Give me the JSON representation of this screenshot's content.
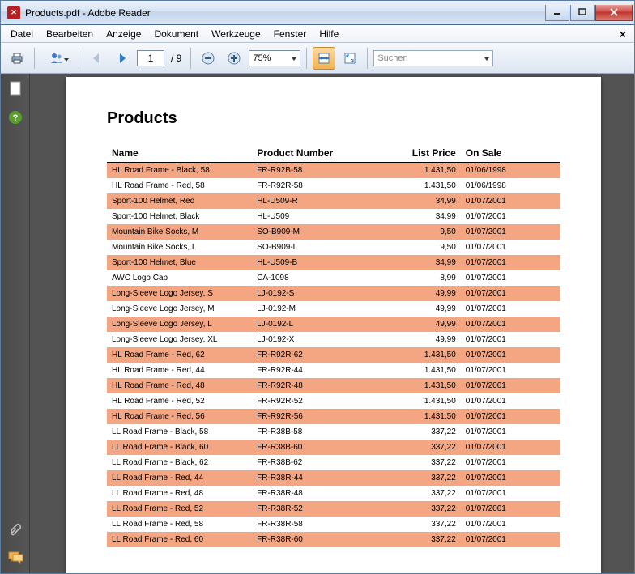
{
  "window": {
    "title": "Products.pdf - Adobe Reader"
  },
  "menu": {
    "items": [
      "Datei",
      "Bearbeiten",
      "Anzeige",
      "Dokument",
      "Werkzeuge",
      "Fenster",
      "Hilfe"
    ]
  },
  "toolbar": {
    "page_current": "1",
    "page_total": "/ 9",
    "zoom": "75%",
    "search_placeholder": "Suchen"
  },
  "document": {
    "title": "Products",
    "headers": {
      "name": "Name",
      "product_number": "Product Number",
      "list_price": "List Price",
      "on_sale": "On Sale"
    },
    "rows": [
      {
        "hl": true,
        "name": "HL Road Frame - Black, 58",
        "num": "FR-R92B-58",
        "price": "1.431,50",
        "date": "01/06/1998"
      },
      {
        "hl": false,
        "name": "HL Road Frame - Red, 58",
        "num": "FR-R92R-58",
        "price": "1.431,50",
        "date": "01/06/1998"
      },
      {
        "hl": true,
        "name": "Sport-100 Helmet, Red",
        "num": "HL-U509-R",
        "price": "34,99",
        "date": "01/07/2001"
      },
      {
        "hl": false,
        "name": "Sport-100 Helmet, Black",
        "num": "HL-U509",
        "price": "34,99",
        "date": "01/07/2001"
      },
      {
        "hl": true,
        "name": "Mountain Bike Socks, M",
        "num": "SO-B909-M",
        "price": "9,50",
        "date": "01/07/2001"
      },
      {
        "hl": false,
        "name": "Mountain Bike Socks, L",
        "num": "SO-B909-L",
        "price": "9,50",
        "date": "01/07/2001"
      },
      {
        "hl": true,
        "name": "Sport-100 Helmet, Blue",
        "num": "HL-U509-B",
        "price": "34,99",
        "date": "01/07/2001"
      },
      {
        "hl": false,
        "name": "AWC Logo Cap",
        "num": "CA-1098",
        "price": "8,99",
        "date": "01/07/2001"
      },
      {
        "hl": true,
        "name": "Long-Sleeve Logo Jersey, S",
        "num": "LJ-0192-S",
        "price": "49,99",
        "date": "01/07/2001"
      },
      {
        "hl": false,
        "name": "Long-Sleeve Logo Jersey, M",
        "num": "LJ-0192-M",
        "price": "49,99",
        "date": "01/07/2001"
      },
      {
        "hl": true,
        "name": "Long-Sleeve Logo Jersey, L",
        "num": "LJ-0192-L",
        "price": "49,99",
        "date": "01/07/2001"
      },
      {
        "hl": false,
        "name": "Long-Sleeve Logo Jersey, XL",
        "num": "LJ-0192-X",
        "price": "49,99",
        "date": "01/07/2001"
      },
      {
        "hl": true,
        "name": "HL Road Frame - Red, 62",
        "num": "FR-R92R-62",
        "price": "1.431,50",
        "date": "01/07/2001"
      },
      {
        "hl": false,
        "name": "HL Road Frame - Red, 44",
        "num": "FR-R92R-44",
        "price": "1.431,50",
        "date": "01/07/2001"
      },
      {
        "hl": true,
        "name": "HL Road Frame - Red, 48",
        "num": "FR-R92R-48",
        "price": "1.431,50",
        "date": "01/07/2001"
      },
      {
        "hl": false,
        "name": "HL Road Frame - Red, 52",
        "num": "FR-R92R-52",
        "price": "1.431,50",
        "date": "01/07/2001"
      },
      {
        "hl": true,
        "name": "HL Road Frame - Red, 56",
        "num": "FR-R92R-56",
        "price": "1.431,50",
        "date": "01/07/2001"
      },
      {
        "hl": false,
        "name": "LL Road Frame - Black, 58",
        "num": "FR-R38B-58",
        "price": "337,22",
        "date": "01/07/2001"
      },
      {
        "hl": true,
        "name": "LL Road Frame - Black, 60",
        "num": "FR-R38B-60",
        "price": "337,22",
        "date": "01/07/2001"
      },
      {
        "hl": false,
        "name": "LL Road Frame - Black, 62",
        "num": "FR-R38B-62",
        "price": "337,22",
        "date": "01/07/2001"
      },
      {
        "hl": true,
        "name": "LL Road Frame - Red, 44",
        "num": "FR-R38R-44",
        "price": "337,22",
        "date": "01/07/2001"
      },
      {
        "hl": false,
        "name": "LL Road Frame - Red, 48",
        "num": "FR-R38R-48",
        "price": "337,22",
        "date": "01/07/2001"
      },
      {
        "hl": true,
        "name": "LL Road Frame - Red, 52",
        "num": "FR-R38R-52",
        "price": "337,22",
        "date": "01/07/2001"
      },
      {
        "hl": false,
        "name": "LL Road Frame - Red, 58",
        "num": "FR-R38R-58",
        "price": "337,22",
        "date": "01/07/2001"
      },
      {
        "hl": true,
        "name": "LL Road Frame - Red, 60",
        "num": "FR-R38R-60",
        "price": "337,22",
        "date": "01/07/2001"
      }
    ]
  }
}
